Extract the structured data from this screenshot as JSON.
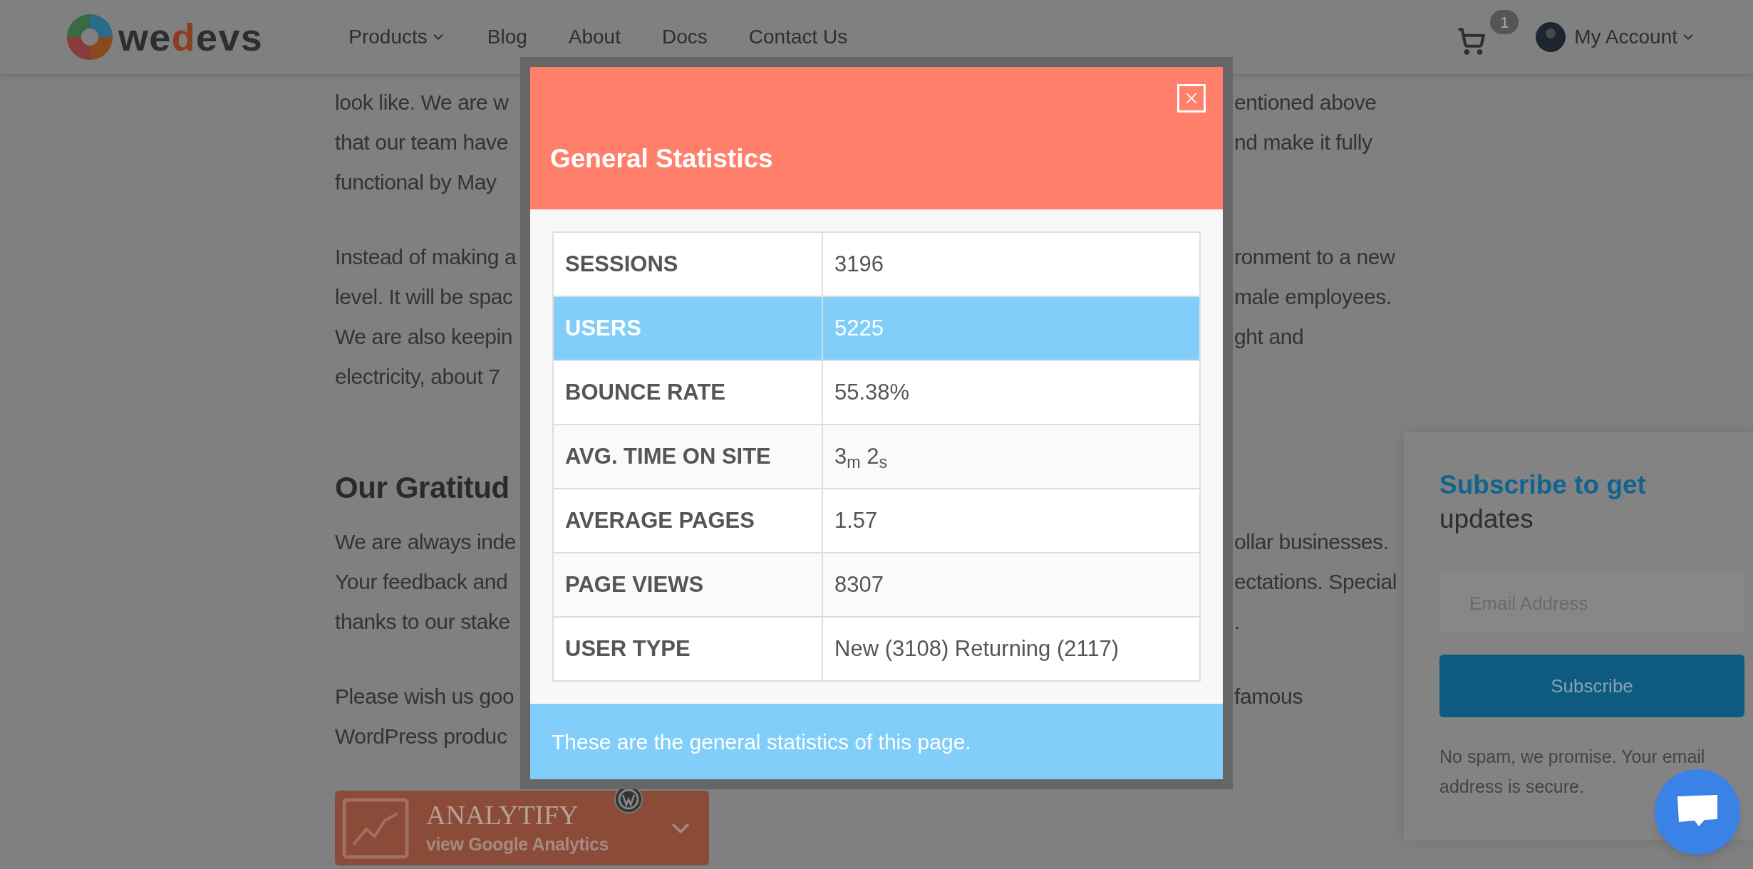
{
  "logo": {
    "prefix": "we",
    "accent": "d",
    "suffix": "evs"
  },
  "nav": {
    "items": [
      {
        "label": "Products",
        "dropdown": true
      },
      {
        "label": "Blog",
        "dropdown": false
      },
      {
        "label": "About",
        "dropdown": false
      },
      {
        "label": "Docs",
        "dropdown": false
      },
      {
        "label": "Contact Us",
        "dropdown": false
      }
    ],
    "cart_count": "1",
    "account": "My Account"
  },
  "article": {
    "blocks": [
      {
        "kind": "paragraph",
        "lines": [
          {
            "left": "look like. We are w",
            "right": "entioned above"
          },
          {
            "left": "that our team have",
            "right": "nd make it fully"
          },
          {
            "left": "functional by May"
          }
        ]
      },
      {
        "kind": "paragraph",
        "lines": [
          {
            "left": "Instead of making a",
            "right": "ronment to a new"
          },
          {
            "left": "level. It will be spac",
            "right": "male employees."
          },
          {
            "left": "We are also keepin",
            "right": "ght and"
          },
          {
            "left": "electricity, about 7"
          }
        ]
      },
      {
        "kind": "heading",
        "text": "Our Gratitud"
      },
      {
        "kind": "paragraph",
        "lines": [
          {
            "left": "We are always inde",
            "right": "ollar businesses."
          },
          {
            "left": "Your feedback and",
            "right": "ectations. Special"
          },
          {
            "left": "thanks to our stake",
            "right": "."
          }
        ]
      },
      {
        "kind": "paragraph",
        "lines": [
          {
            "left": "Please wish us goo",
            "right": "famous"
          },
          {
            "left": "WordPress produc"
          }
        ]
      }
    ]
  },
  "analytify_button": {
    "title": "ANALYTIFY",
    "subtitle": "view Google Analytics"
  },
  "modal": {
    "title": "General Statistics",
    "rows": [
      {
        "label": "SESSIONS",
        "value": "3196",
        "highlighted": false
      },
      {
        "label": "USERS",
        "value": "5225",
        "highlighted": true
      },
      {
        "label": "BOUNCE RATE",
        "value": "55.38%",
        "highlighted": false
      },
      {
        "label": "AVG. TIME ON SITE",
        "value": "3$_{m}$ 2$_{s}$",
        "highlighted": false
      },
      {
        "label": "AVERAGE PAGES",
        "value": "1.57",
        "highlighted": false
      },
      {
        "label": "PAGE VIEWS",
        "value": "8307",
        "highlighted": false
      },
      {
        "label": "USER TYPE",
        "value": "New (3108) Returning (2117)",
        "highlighted": false
      }
    ],
    "footer": "These are the general statistics of this page."
  },
  "subscribe": {
    "title": "Subscribe to get",
    "subtitle": "updates",
    "email_field": {
      "placeholder": "Email Address"
    },
    "button": "Subscribe",
    "note": "No spam, we promise. Your email address is secure."
  }
}
